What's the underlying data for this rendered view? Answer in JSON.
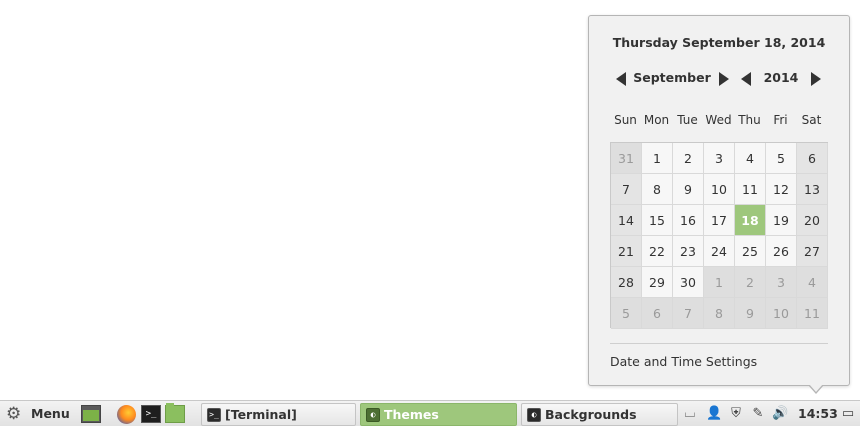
{
  "calendar": {
    "heading": "Thursday September 18, 2014",
    "month": "September",
    "year": "2014",
    "weekdays": [
      "Sun",
      "Mon",
      "Tue",
      "Wed",
      "Thu",
      "Fri",
      "Sat"
    ],
    "weeks": [
      [
        "31",
        "1",
        "2",
        "3",
        "4",
        "5",
        "6"
      ],
      [
        "7",
        "8",
        "9",
        "10",
        "11",
        "12",
        "13"
      ],
      [
        "14",
        "15",
        "16",
        "17",
        "18",
        "19",
        "20"
      ],
      [
        "21",
        "22",
        "23",
        "24",
        "25",
        "26",
        "27"
      ],
      [
        "28",
        "29",
        "30",
        "1",
        "2",
        "3",
        "4"
      ],
      [
        "5",
        "6",
        "7",
        "8",
        "9",
        "10",
        "11"
      ]
    ],
    "today": "18",
    "settings_label": "Date and Time Settings",
    "today_color": "#9ec77c"
  },
  "panel": {
    "menu_label": "Menu",
    "launchers": [
      "desktop-icon",
      "firefox-icon",
      "terminal-icon",
      "files-icon"
    ],
    "tasks": [
      {
        "label": "[Terminal]",
        "icon": "terminal-icon",
        "active": false
      },
      {
        "label": "Themes",
        "icon": "themes-icon",
        "active": true
      },
      {
        "label": "Backgrounds",
        "icon": "backgrounds-icon",
        "active": false
      }
    ],
    "tray": [
      "keyboard-icon",
      "user-icon",
      "update-manager-icon",
      "network-icon",
      "volume-icon"
    ],
    "clock": "14:53",
    "show_desktop": "show-desktop-icon",
    "accent_color": "#9ec77c"
  }
}
